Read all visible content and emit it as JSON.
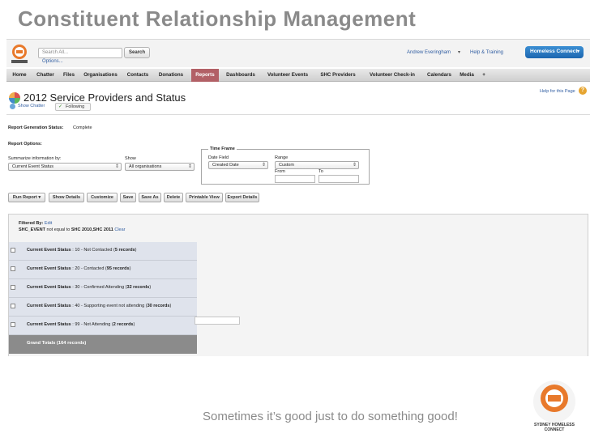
{
  "slide": {
    "title": "Constituent Relationship Management",
    "tagline": "Sometimes it’s good just to do something good!",
    "logo_text": "SYDNEY HOMELESS CONNECT"
  },
  "header": {
    "search_placeholder": "Search All...",
    "search_button": "Search",
    "options_link": "Options...",
    "user_name": "Andrew Everingham",
    "help_training": "Help & Training",
    "app_name": "Homeless Connect"
  },
  "nav": {
    "tabs": [
      {
        "label": "Home"
      },
      {
        "label": "Chatter"
      },
      {
        "label": "Files"
      },
      {
        "label": "Organisations"
      },
      {
        "label": "Contacts"
      },
      {
        "label": "Donations"
      },
      {
        "label": "Reports"
      },
      {
        "label": "Dashboards"
      },
      {
        "label": "Volunteer Events"
      },
      {
        "label": "SHC Providers"
      },
      {
        "label": "Volunteer Check-in"
      },
      {
        "label": "Calendars"
      },
      {
        "label": "Media"
      },
      {
        "label": "+"
      }
    ],
    "active_tab": "Reports"
  },
  "page": {
    "title": "2012 Service Providers and Status",
    "help_link": "Help for this Page",
    "show_chatter": "Show Chatter",
    "following": "Following"
  },
  "report": {
    "generation_label": "Report Generation Status:",
    "generation_value": "Complete",
    "options_label": "Report Options:",
    "summarize_label": "Summarize information by:",
    "summarize_value": "Current Event Status",
    "show_label": "Show",
    "show_value": "All organisations",
    "timeframe_label": "Time Frame",
    "date_field_label": "Date Field",
    "date_field_value": "Created Date",
    "range_label": "Range",
    "range_value": "Custom",
    "from_label": "From",
    "to_label": "To"
  },
  "toolbar": {
    "buttons": [
      {
        "label": "Run Report"
      },
      {
        "label": "Show Details"
      },
      {
        "label": "Customize"
      },
      {
        "label": "Save"
      },
      {
        "label": "Save As"
      },
      {
        "label": "Delete"
      },
      {
        "label": "Printable View"
      },
      {
        "label": "Export Details"
      }
    ]
  },
  "filter": {
    "label": "Filtered By:",
    "edit": "Edit",
    "field": "SHC_EVENT",
    "operator": "not equal to",
    "value": "SHC 2010,SHC 2011",
    "clear": "Clear"
  },
  "groups": {
    "rows": [
      {
        "field": "Current Event Status",
        "value": "10 - Not Contacted",
        "count": "5 records"
      },
      {
        "field": "Current Event Status",
        "value": "20 - Contacted",
        "count": "95 records"
      },
      {
        "field": "Current Event Status",
        "value": "30 - Confirmed Attending",
        "count": "32 records"
      },
      {
        "field": "Current Event Status",
        "value": "40 - Supporting event not attending",
        "count": "30 records"
      },
      {
        "field": "Current Event Status",
        "value": "99 - Not Attending",
        "count": "2 records"
      }
    ],
    "grand_total": "Grand Totals (164 records)"
  },
  "colors": {
    "active_tab": "#b26066",
    "link": "#315ea2",
    "app_button": "#1c66b0",
    "brand_orange": "#e8792b"
  }
}
